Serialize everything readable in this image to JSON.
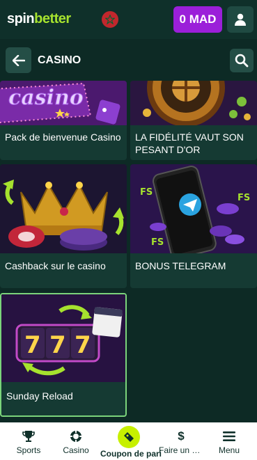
{
  "header": {
    "logo_part1": "spin",
    "logo_part2": "better",
    "balance_label": "0 MAD"
  },
  "subheader": {
    "title": "CASINO"
  },
  "cards": [
    {
      "title": "Pack de bienvenue Casino"
    },
    {
      "title": "LA FIDÉLITÉ VAUT SON PESANT D'OR"
    },
    {
      "title": "Cashback sur le casino"
    },
    {
      "title": "BONUS TELEGRAM"
    },
    {
      "title": "Sunday Reload"
    }
  ],
  "bottom_nav": {
    "sports": "Sports",
    "casino": "Casino",
    "coupon": "Coupon de pari",
    "deposit": "Faire un d…",
    "menu": "Menu"
  },
  "colors": {
    "background": "#0d2a25",
    "header_bg": "#0f302a",
    "accent_purple": "#9b1fd9",
    "accent_lime": "#a6e22e",
    "coupon_lime": "#c7f000",
    "selected_border": "#7bd47b"
  }
}
